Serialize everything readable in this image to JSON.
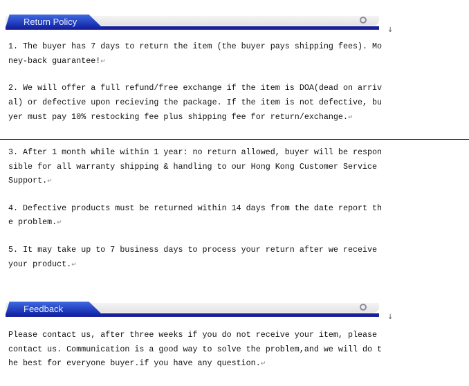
{
  "sections": [
    {
      "title": "Return Policy",
      "paragraphs": [
        [
          "1. The buyer has 7 days to return the item (the buyer pays shipping fees). Mo",
          "ney-back guarantee!"
        ],
        [
          "2. We will offer a full refund/free exchange if the item is DOA(dead on arriv",
          "al) or defective upon recieving the package. If the item is not defective, bu",
          "yer must pay 10% restocking fee plus shipping fee for return/exchange."
        ],
        [
          "3. After 1 month while within 1 year: no return allowed, buyer will be respon",
          "sible for all warranty shipping & handling to our Hong Kong Customer Service",
          "Support."
        ],
        [
          "4. Defective products must be returned within 14 days from the date report th",
          "e problem."
        ],
        [
          "5. It may take up to 7 business days to process your return after we receive",
          "your product."
        ]
      ]
    },
    {
      "title": "Feedback",
      "paragraphs": [
        [
          "Please contact us, after three weeks if you do not receive your item, please",
          "contact us. Communication is a good way to solve the problem,and we will do t",
          "he best for everyone buyer.if you have any question."
        ]
      ]
    }
  ],
  "paragraph_mark": "↵",
  "colors": {
    "banner_blue": "#1a1f9a",
    "tab_blue": "#2a4cc8"
  }
}
